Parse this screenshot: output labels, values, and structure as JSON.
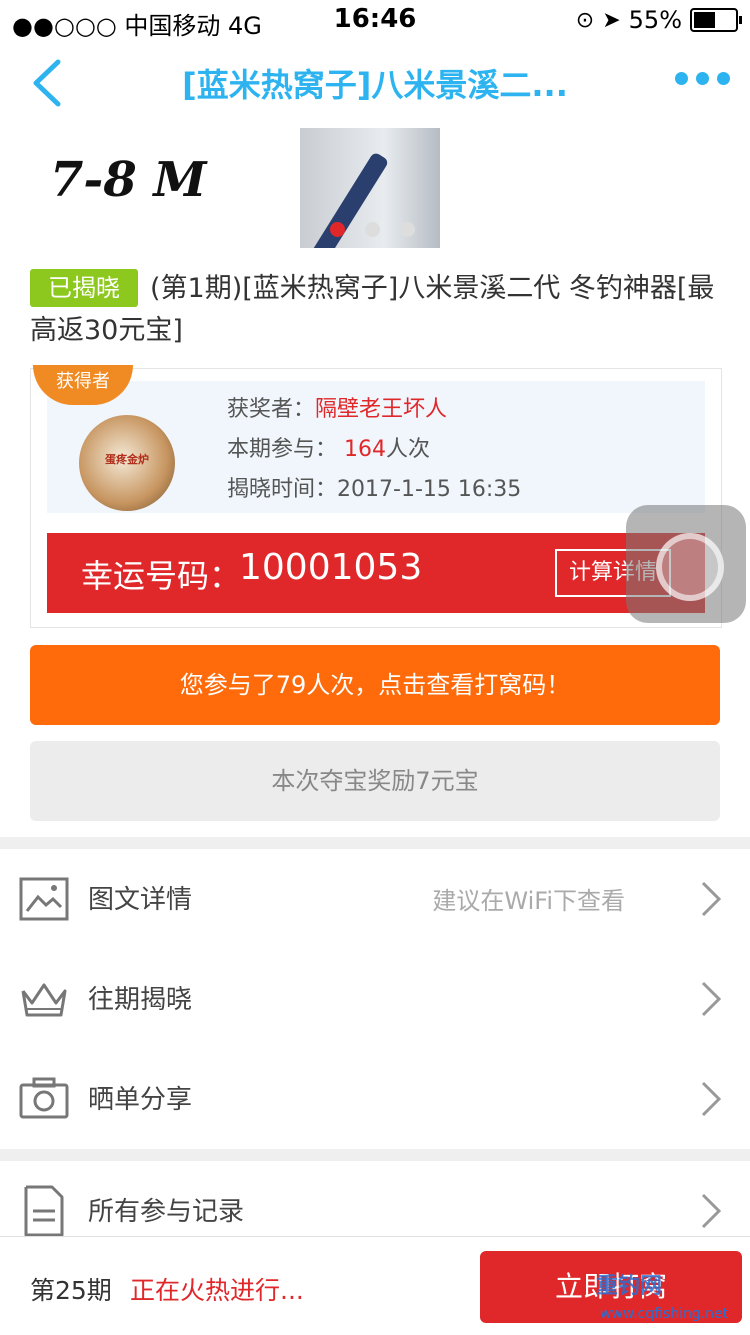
{
  "status": {
    "carrier": "●●○○○ 中国移动  4G",
    "time": "16:46",
    "battery": "55%",
    "battery_level": 0.55
  },
  "nav": {
    "title": "[蓝米热窝子]八米景溪二...",
    "back_icon": "chevron-left-icon",
    "more_icon": "more-dots-icon",
    "accent": "#2db4f0"
  },
  "banner": {
    "text": "7-8 M",
    "slide_count": 3,
    "active_slide": 1
  },
  "product": {
    "status_badge": "已揭晓",
    "title": "(第1期)[蓝米热窝子]八米景溪二代 冬钓神器[最高返30元宝]"
  },
  "winner": {
    "ribbon": "获得者",
    "avatar_text": "蛋疼金炉",
    "winner_label": "获奖者：",
    "winner_name": "隔壁老王坏人",
    "participation_label": "本期参与：",
    "participation_value": "164",
    "participation_unit": "人次",
    "reveal_label": "揭晓时间：",
    "reveal_time": "2017-1-15 16:35",
    "lucky_label": "幸运号码：",
    "lucky_number": "10001053",
    "calc_button": "计算详情"
  },
  "actions": {
    "orange_button": "您参与了79人次，点击查看打窝码！",
    "gray_button": "本次夺宝奖励7元宝"
  },
  "list": [
    {
      "icon": "image-icon",
      "label": "图文详情",
      "hint": "建议在WiFi下查看"
    },
    {
      "icon": "crown-icon",
      "label": "往期揭晓",
      "hint": ""
    },
    {
      "icon": "camera-icon",
      "label": "晒单分享",
      "hint": ""
    },
    {
      "icon": "document-icon",
      "label": "所有参与记录",
      "hint": ""
    }
  ],
  "bottom": {
    "issue": "第25期",
    "live_text": "正在火热进行...",
    "join_button": "立即打窝"
  },
  "watermark": {
    "text": "重钓网",
    "url": "www.cqfishing.net"
  },
  "colors": {
    "red": "#e0282b",
    "orange": "#ff6a0a",
    "green": "#8cc81e",
    "blue": "#2db4f0"
  }
}
